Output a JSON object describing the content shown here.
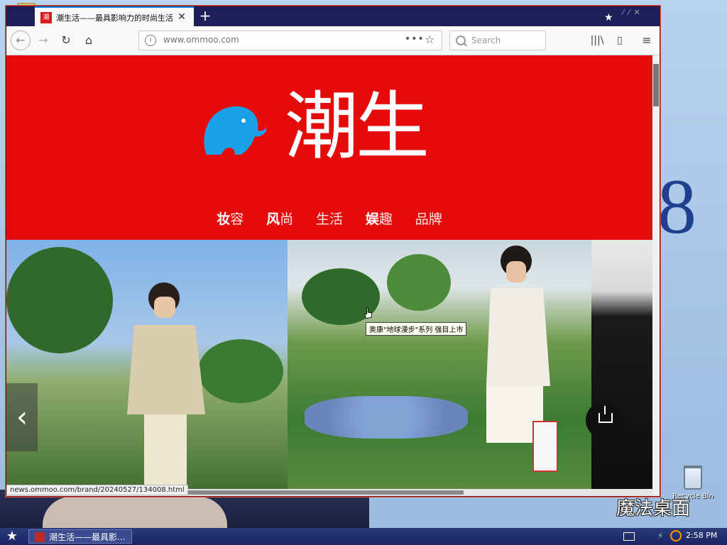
{
  "browser": {
    "tab_title": "潮生活——最具影响力的时尚生活",
    "tab_favicon": "潮",
    "new_tab": "+",
    "url": "www.ommoo.com",
    "url_more": "•••",
    "search_placeholder": "Search",
    "status_url": "news.ommoo.com/brand/20240527/134008.html"
  },
  "site": {
    "logo_text": "潮生",
    "nav": [
      {
        "label_bold": "妆",
        "label_rest": "容"
      },
      {
        "label_bold": "风",
        "label_rest": "尚"
      },
      {
        "label_bold": "",
        "label_rest": "生活"
      },
      {
        "label_bold": "娱",
        "label_rest": "趣"
      },
      {
        "label_bold": "",
        "label_rest": "品牌"
      }
    ],
    "tooltip": "奥康\"地球漫步\"系列 强目上市",
    "prev_arrow": "‹"
  },
  "desktop": {
    "big_char": "8",
    "recycle_bin_label": "Recycle Bin",
    "brand_sign": "魔法桌面"
  },
  "taskbar": {
    "task_label": "潮生活——最具影...",
    "clock": "2:58 PM"
  },
  "colors": {
    "site_red": "#e60b0b",
    "tab_bar": "#1d1f5a",
    "taskbar": "#1a2563",
    "elephant_blue": "#1aa0e6"
  },
  "icons": [
    "back-icon",
    "forward-icon",
    "reload-icon",
    "home-icon",
    "info-icon",
    "bookmark-star-icon",
    "search-icon",
    "library-icon",
    "sidebar-icon",
    "menu-icon",
    "share-icon",
    "start-icon"
  ]
}
